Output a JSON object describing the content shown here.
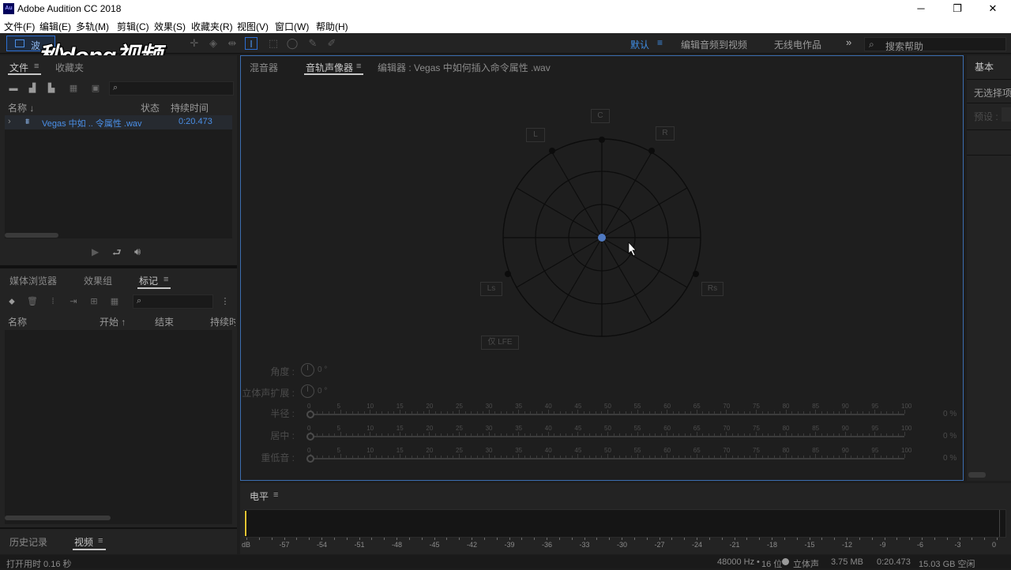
{
  "window": {
    "icon_text": "Au",
    "title": "Adobe Audition CC 2018",
    "minimize": "─",
    "restore": "❐",
    "close": "✕"
  },
  "menu": [
    "文件(F)",
    "编辑(E)",
    "多轨(M)",
    "剪辑(C)",
    "效果(S)",
    "收藏夹(R)",
    "视图(V)",
    "窗口(W)",
    "帮助(H)"
  ],
  "toolbar": {
    "mode_label": "波",
    "watermark": "秒dong视频",
    "workspaces": {
      "default": "默认",
      "menu": "≡",
      "edit_video": "编辑音频到视频",
      "radio": "无线电作品",
      "more": "»"
    },
    "help_search_placeholder": "搜索帮助"
  },
  "files_panel": {
    "tabs": [
      "文件",
      "收藏夹"
    ],
    "menu": "≡",
    "columns": {
      "name": "名称 ↓",
      "status": "状态",
      "duration": "持续时间"
    },
    "files": [
      {
        "name": "Vegas 中如 .. 令属性 .wav",
        "duration": "0:20.473"
      }
    ]
  },
  "markers_panel": {
    "tabs": [
      "媒体浏览器",
      "效果组",
      "标记"
    ],
    "menu": "≡",
    "columns": {
      "name": "名称",
      "start": "开始 ↑",
      "end": "结束",
      "duration": "持续时"
    }
  },
  "history_panel": {
    "tabs": [
      "历史记录",
      "视频"
    ],
    "menu": "≡"
  },
  "main_panel": {
    "tabs": [
      "混音器",
      "音轨声像器",
      "编辑器 : Vegas 中如何插入命令属性 .wav"
    ],
    "menu": "≡",
    "speakers": {
      "L": "L",
      "C": "C",
      "R": "R",
      "Ls": "Ls",
      "Rs": "Rs",
      "LFE": "仅 LFE"
    },
    "controls": {
      "angle_label": "角度 :",
      "angle_value": "0 °",
      "stereo_spread_label": "立体声扩展 :",
      "stereo_spread_value": "0 °",
      "sliders": [
        {
          "label": "半径 :",
          "value": "0 %"
        },
        {
          "label": "居中 :",
          "value": "0 %"
        },
        {
          "label": "重低音 :",
          "value": "0 %"
        }
      ],
      "ticks": [
        "0",
        "5",
        "10",
        "15",
        "20",
        "25",
        "30",
        "35",
        "40",
        "45",
        "50",
        "55",
        "60",
        "65",
        "70",
        "75",
        "80",
        "85",
        "90",
        "95",
        "100"
      ]
    }
  },
  "props_panel": {
    "tab": "基本",
    "no_selection": "无选择项",
    "preset_label": "预设 :"
  },
  "level_panel": {
    "title": "电平",
    "menu": "≡",
    "scale": [
      "dB",
      "-57",
      "-54",
      "-51",
      "-48",
      "-45",
      "-42",
      "-39",
      "-36",
      "-33",
      "-30",
      "-27",
      "-24",
      "-21",
      "-18",
      "-15",
      "-12",
      "-9",
      "-6",
      "-3",
      "0"
    ]
  },
  "status": {
    "open_time": "打开用时 0.16 秒",
    "sample_rate": "48000 Hz",
    "bit_depth": "16 位",
    "channels": "立体声",
    "file_size": "3.75 MB",
    "duration": "0:20.473",
    "free_space": "15.03 GB 空闲"
  }
}
